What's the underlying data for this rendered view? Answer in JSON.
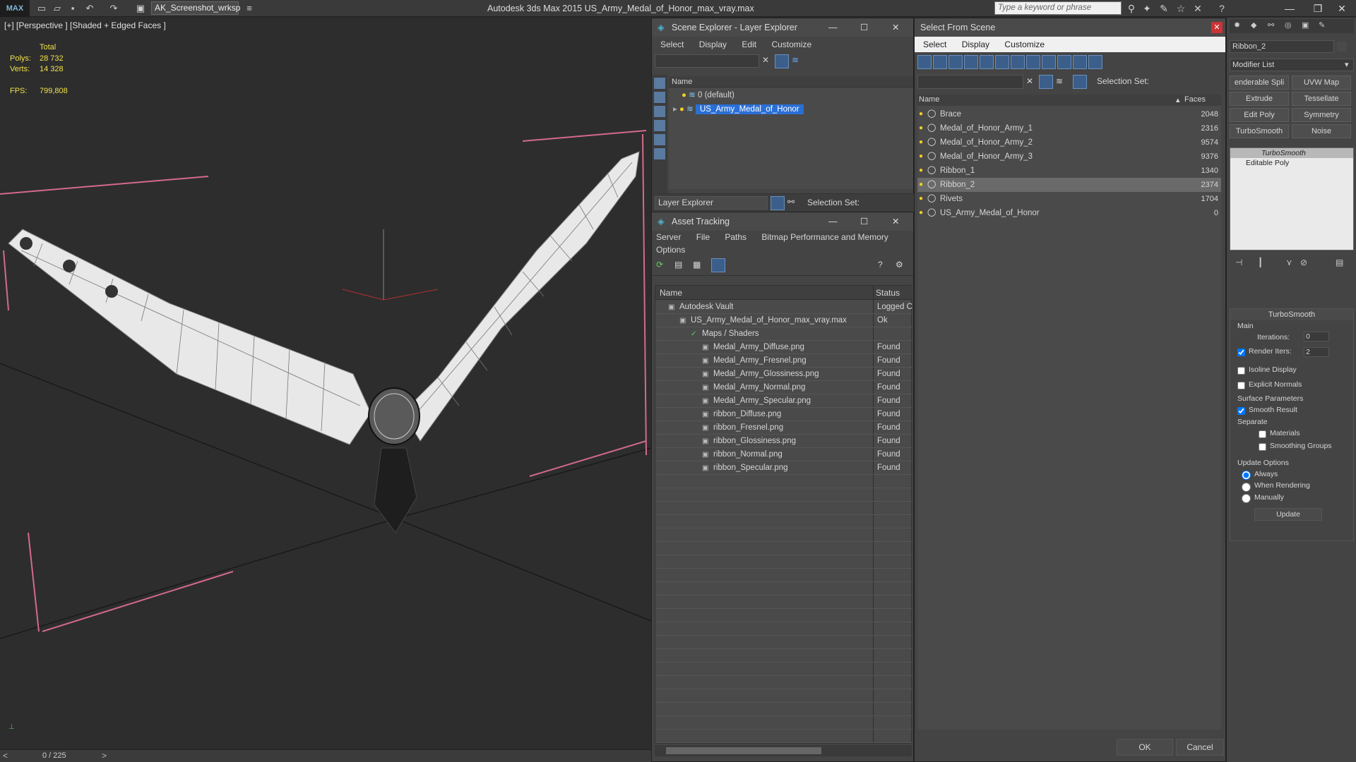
{
  "titlebar": {
    "logo": "MAX",
    "workspace": "AK_Screenshot_wrksp",
    "app_title": "Autodesk 3ds Max  2015     US_Army_Medal_of_Honor_max_vray.max",
    "search_placeholder": "Type a keyword or phrase"
  },
  "viewport": {
    "label": "[+] [Perspective ] [Shaded + Edged Faces ]",
    "stats_header": "Total",
    "polys_label": "Polys:",
    "polys_value": "28 732",
    "verts_label": "Verts:",
    "verts_value": "14 328",
    "fps_label": "FPS:",
    "fps_value": "799,808",
    "timeline": "0 / 225"
  },
  "scene_explorer": {
    "title": "Scene Explorer - Layer Explorer",
    "menu": [
      "Select",
      "Display",
      "Edit",
      "Customize"
    ],
    "column_name": "Name",
    "layers": [
      "0 (default)",
      "US_Army_Medal_of_Honor"
    ],
    "footer_label": "Layer Explorer",
    "selection_set": "Selection Set:"
  },
  "asset_tracking": {
    "title": "Asset Tracking",
    "menu": [
      "Server",
      "File",
      "Paths",
      "Bitmap Performance and Memory"
    ],
    "menu2": "Options",
    "col_name": "Name",
    "col_status": "Status",
    "rows": [
      {
        "name": "Autodesk Vault",
        "status": "Logged C",
        "indent": 0
      },
      {
        "name": "US_Army_Medal_of_Honor_max_vray.max",
        "status": "Ok",
        "indent": 1
      },
      {
        "name": "Maps / Shaders",
        "status": "",
        "indent": 2
      },
      {
        "name": "Medal_Army_Diffuse.png",
        "status": "Found",
        "indent": 3
      },
      {
        "name": "Medal_Army_Fresnel.png",
        "status": "Found",
        "indent": 3
      },
      {
        "name": "Medal_Army_Glossiness.png",
        "status": "Found",
        "indent": 3
      },
      {
        "name": "Medal_Army_Normal.png",
        "status": "Found",
        "indent": 3
      },
      {
        "name": "Medal_Army_Specular.png",
        "status": "Found",
        "indent": 3
      },
      {
        "name": "ribbon_Diffuse.png",
        "status": "Found",
        "indent": 3
      },
      {
        "name": "ribbon_Fresnel.png",
        "status": "Found",
        "indent": 3
      },
      {
        "name": "ribbon_Glossiness.png",
        "status": "Found",
        "indent": 3
      },
      {
        "name": "ribbon_Normal.png",
        "status": "Found",
        "indent": 3
      },
      {
        "name": "ribbon_Specular.png",
        "status": "Found",
        "indent": 3
      }
    ]
  },
  "select_from_scene": {
    "title": "Select From Scene",
    "menu": [
      "Select",
      "Display",
      "Customize"
    ],
    "selection_set": "Selection Set:",
    "col_name": "Name",
    "col_faces": "Faces",
    "objects": [
      {
        "name": "Brace",
        "faces": "2048"
      },
      {
        "name": "Medal_of_Honor_Army_1",
        "faces": "2316"
      },
      {
        "name": "Medal_of_Honor_Army_2",
        "faces": "9574"
      },
      {
        "name": "Medal_of_Honor_Army_3",
        "faces": "9376"
      },
      {
        "name": "Ribbon_1",
        "faces": "1340"
      },
      {
        "name": "Ribbon_2",
        "faces": "2374"
      },
      {
        "name": "Rivets",
        "faces": "1704"
      },
      {
        "name": "US_Army_Medal_of_Honor",
        "faces": "0"
      }
    ],
    "ok": "OK",
    "cancel": "Cancel"
  },
  "command_panel": {
    "object_name": "Ribbon_2",
    "modifier_list": "Modifier List",
    "buttons": [
      "enderable Spli",
      "UVW Map",
      "Extrude",
      "Tessellate",
      "Edit Poly",
      "Symmetry",
      "TurboSmooth",
      "Noise"
    ],
    "stack": [
      "TurboSmooth",
      "Editable Poly"
    ],
    "rollout_title": "TurboSmooth",
    "main_label": "Main",
    "iterations_label": "Iterations:",
    "iterations_value": "0",
    "render_iters_label": "Render Iters:",
    "render_iters_value": "2",
    "isoline": "Isoline Display",
    "explicit": "Explicit Normals",
    "surface_params": "Surface Parameters",
    "smooth_result": "Smooth Result",
    "separate": "Separate",
    "materials": "Materials",
    "smoothing_groups": "Smoothing Groups",
    "update_options": "Update Options",
    "always": "Always",
    "when_rendering": "When Rendering",
    "manually": "Manually",
    "update": "Update"
  }
}
